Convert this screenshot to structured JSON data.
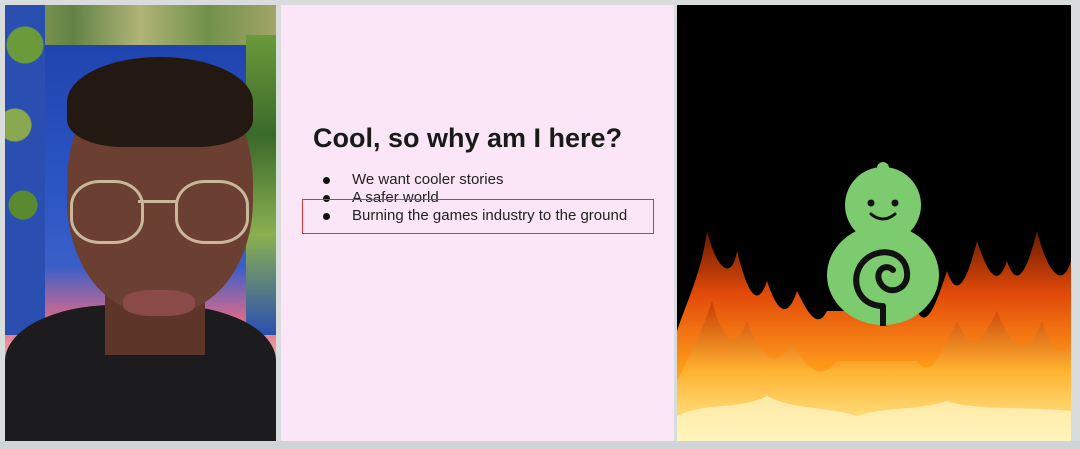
{
  "slide": {
    "title": "Cool, so why am I here?",
    "bullets": [
      "We want cooler stories",
      "A safer world",
      "Burning the games industry to the ground"
    ],
    "highlighted_bullet_index": 2
  },
  "panels": {
    "webcam": "presenter-video",
    "image": "mascot-in-flames"
  },
  "colors": {
    "slide_background": "#fbe6f7",
    "highlight_border": "#e0303a",
    "mascot_green": "#7ccb6f",
    "fire_dark": "#000000"
  }
}
